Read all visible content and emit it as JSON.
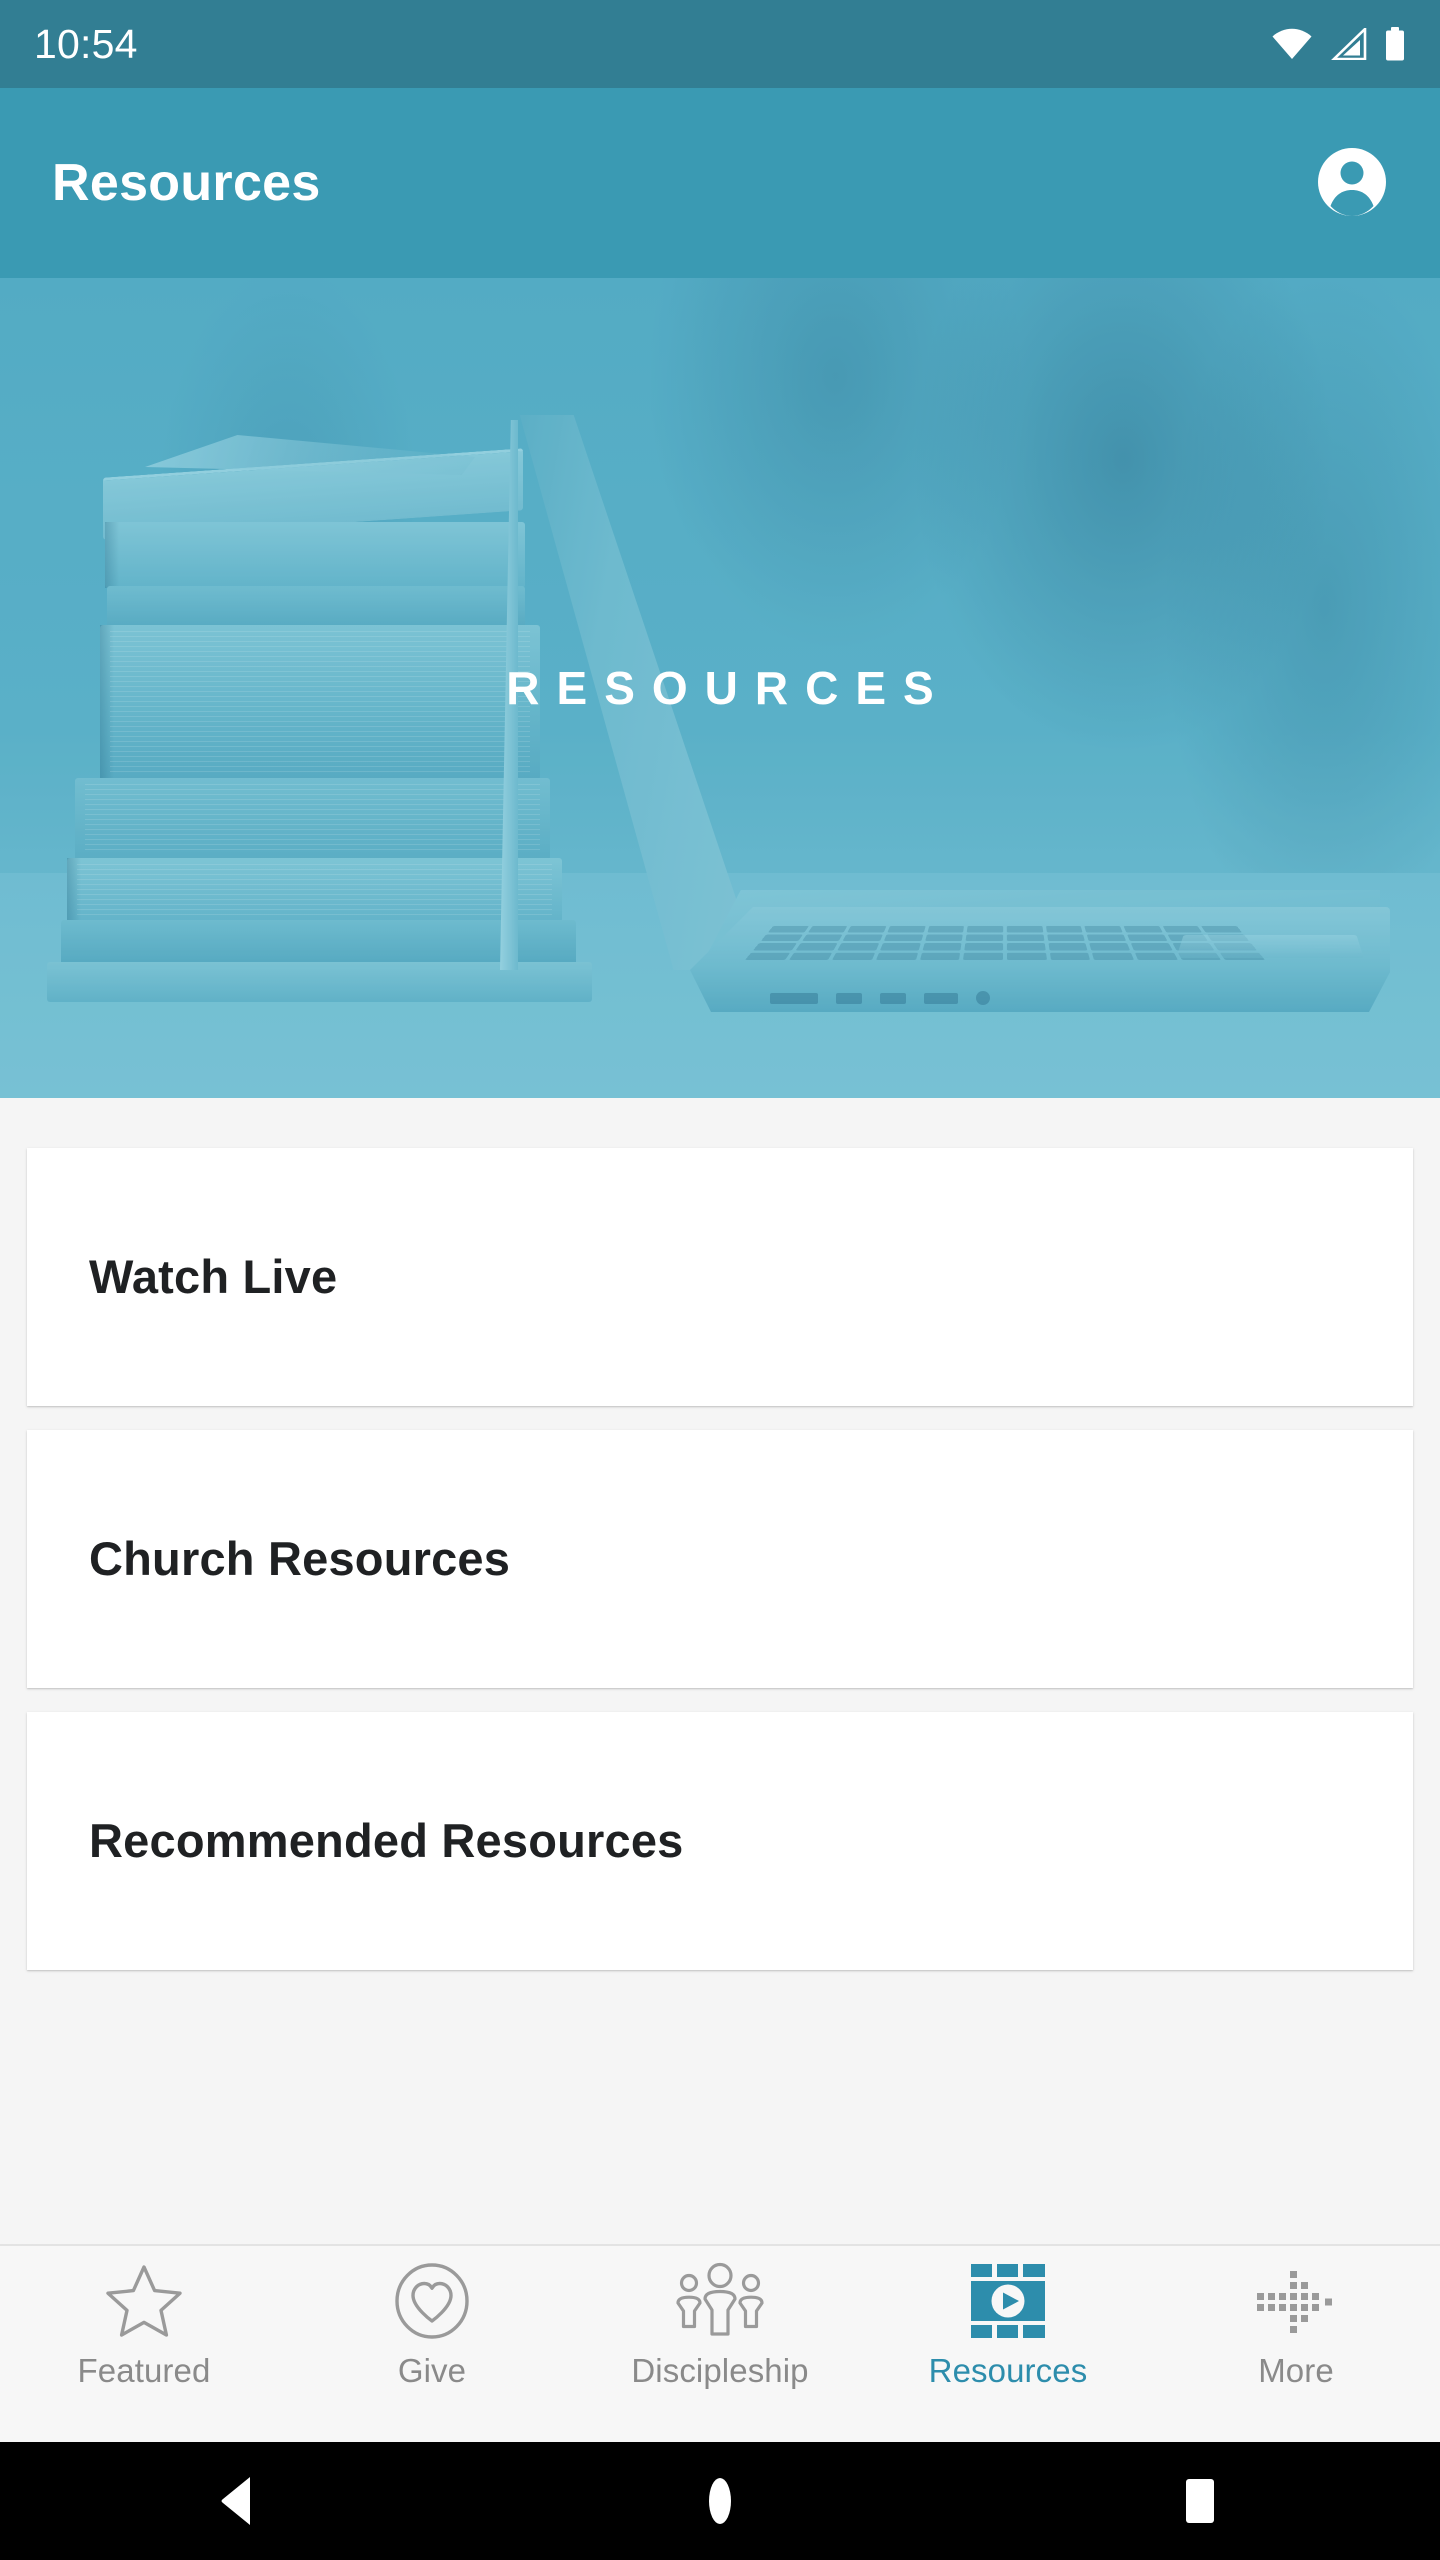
{
  "status_bar": {
    "time": "10:54",
    "icons": [
      "wifi-icon",
      "cellular-signal-icon",
      "battery-icon"
    ],
    "background": "#327E93"
  },
  "app_bar": {
    "title": "Resources",
    "background": "#3A9AB3",
    "avatar_icon": "account-circle-icon"
  },
  "hero": {
    "overlay_title": "RESOURCES",
    "image_description": "stack-of-books-and-laptop",
    "tint_color": "#5FB3CC"
  },
  "content": {
    "background": "#F5F5F5",
    "cards": [
      {
        "title": "Watch Live"
      },
      {
        "title": "Church Resources"
      },
      {
        "title": "Recommended Resources"
      }
    ]
  },
  "bottom_nav": {
    "active_color": "#2D8DAC",
    "inactive_color": "#8A8A8A",
    "items": [
      {
        "label": "Featured",
        "icon": "star-outline-icon",
        "active": false
      },
      {
        "label": "Give",
        "icon": "heart-circle-icon",
        "active": false
      },
      {
        "label": "Discipleship",
        "icon": "people-group-icon",
        "active": false
      },
      {
        "label": "Resources",
        "icon": "film-strip-play-icon",
        "active": true
      },
      {
        "label": "More",
        "icon": "dotted-arrow-icon",
        "active": false
      }
    ]
  },
  "android_nav": {
    "background": "#000000",
    "buttons": [
      {
        "label": "Back",
        "icon": "back-triangle-icon"
      },
      {
        "label": "Home",
        "icon": "home-circle-icon"
      },
      {
        "label": "Recents",
        "icon": "recents-square-icon"
      }
    ]
  }
}
